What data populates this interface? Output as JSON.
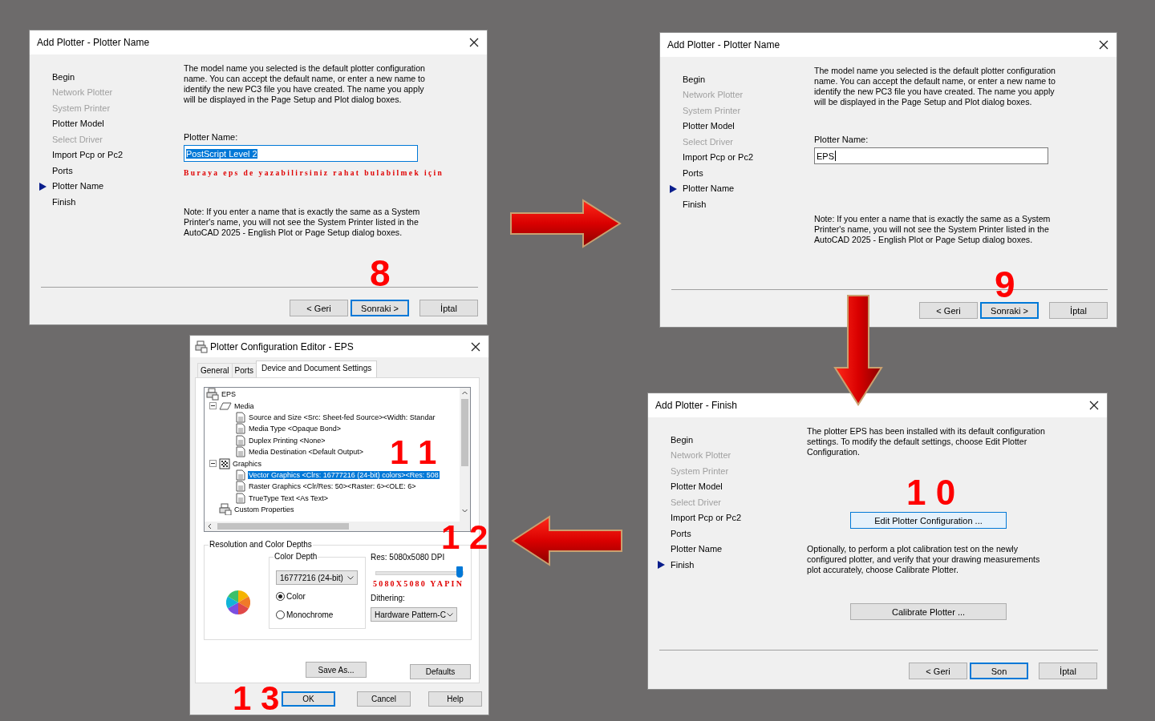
{
  "dialogs": [
    {
      "kind": "wizard",
      "title": "Add Plotter - Plotter Name",
      "steps": [
        {
          "label": "Begin",
          "disabled": false,
          "current": false
        },
        {
          "label": "Network Plotter",
          "disabled": true,
          "current": false
        },
        {
          "label": "System Printer",
          "disabled": true,
          "current": false
        },
        {
          "label": "Plotter Model",
          "disabled": false,
          "current": false
        },
        {
          "label": "Select Driver",
          "disabled": true,
          "current": false
        },
        {
          "label": "Import Pcp or Pc2",
          "disabled": false,
          "current": false
        },
        {
          "label": "Ports",
          "disabled": false,
          "current": false
        },
        {
          "label": "Plotter Name",
          "disabled": false,
          "current": true
        },
        {
          "label": "Finish",
          "disabled": false,
          "current": false
        }
      ],
      "content": [
        {
          "kind": "text",
          "text": "The model name you selected is the default plotter configuration name. You can accept the default name, or enter a new name to identify the new PC3 file you have created. The name you apply will be displayed in the Page Setup and Plot dialog boxes."
        },
        {
          "kind": "field",
          "label": "Plotter Name:",
          "value": "PostScript Level 2",
          "selected": true,
          "caret": false
        },
        {
          "kind": "hint",
          "text": "Buraya eps de yazabilirsiniz rahat bulabilmek için"
        },
        {
          "kind": "text",
          "text": "Note: If you enter a name that is exactly the same as a System Printer's name, you will not see the System Printer listed in the AutoCAD 2025 - English Plot or Page Setup dialog boxes."
        }
      ],
      "badges": [
        "8"
      ],
      "buttons": [
        {
          "label": "< Geri",
          "default": false
        },
        {
          "label": "Sonraki >",
          "default": true
        },
        {
          "label": "İptal",
          "default": false
        }
      ]
    },
    {
      "kind": "wizard",
      "title": "Add Plotter - Plotter Name",
      "steps": [
        {
          "label": "Begin",
          "disabled": false,
          "current": false
        },
        {
          "label": "Network Plotter",
          "disabled": true,
          "current": false
        },
        {
          "label": "System Printer",
          "disabled": true,
          "current": false
        },
        {
          "label": "Plotter Model",
          "disabled": false,
          "current": false
        },
        {
          "label": "Select Driver",
          "disabled": true,
          "current": false
        },
        {
          "label": "Import Pcp or Pc2",
          "disabled": false,
          "current": false
        },
        {
          "label": "Ports",
          "disabled": false,
          "current": false
        },
        {
          "label": "Plotter Name",
          "disabled": false,
          "current": true
        },
        {
          "label": "Finish",
          "disabled": false,
          "current": false
        }
      ],
      "content": [
        {
          "kind": "text",
          "text": "The model name you selected is the default plotter configuration name. You can accept the default name, or enter a new name to identify the new PC3 file you have created. The name you apply will be displayed in the Page Setup and Plot dialog boxes."
        },
        {
          "kind": "field",
          "label": "Plotter Name:",
          "value": "EPS",
          "selected": false,
          "caret": true
        },
        {
          "kind": "text",
          "text": "Note: If you enter a name that is exactly the same as a System Printer's name, you will not see the System Printer listed in the AutoCAD 2025 - English Plot or Page Setup dialog boxes."
        }
      ],
      "badges": [
        "9"
      ],
      "buttons": [
        {
          "label": "< Geri",
          "default": false
        },
        {
          "label": "Sonraki >",
          "default": true
        },
        {
          "label": "İptal",
          "default": false
        }
      ]
    },
    {
      "kind": "config",
      "title": "Plotter Configuration Editor - EPS",
      "tabs": [
        {
          "label": "General",
          "selected": false
        },
        {
          "label": "Ports",
          "selected": false
        },
        {
          "label": "Device and Document Settings",
          "selected": true
        }
      ],
      "tree": [
        {
          "label": "EPS",
          "selected": false,
          "children": [
            {
              "label": "Media",
              "expanded": true,
              "selected": false,
              "children": [
                {
                  "label": "Source and Size <Src:  Sheet-fed Source><Width: Standar",
                  "selected": false
                },
                {
                  "label": "Media Type <Opaque Bond>",
                  "selected": false
                },
                {
                  "label": "Duplex Printing <None>",
                  "selected": false
                },
                {
                  "label": "Media Destination <Default Output>",
                  "selected": false
                }
              ]
            },
            {
              "label": "Graphics",
              "expanded": true,
              "selected": false,
              "children": [
                {
                  "label": "Vector Graphics <Clrs: 16777216  (24-bit) colors><Res: 508",
                  "selected": true
                },
                {
                  "label": "Raster Graphics <Clr/Res: 50><Raster: 6><OLE: 6>",
                  "selected": false
                },
                {
                  "label": "TrueType Text <As Text>",
                  "selected": false
                }
              ]
            },
            {
              "label": "Custom Properties",
              "selected": false
            }
          ]
        }
      ],
      "group_title": "Resolution and Color Depths",
      "color_depth": {
        "title": "Color Depth",
        "value": "16777216  (24-bit)",
        "options": [
          {
            "label": "Color",
            "selected": true
          },
          {
            "label": "Monochrome",
            "selected": false
          }
        ]
      },
      "resolution": {
        "label": "Res: 5080x5080 DPI",
        "level": 0.95,
        "hint": "5080X5080 YAPIN"
      },
      "dithering": {
        "label": "Dithering:",
        "value": "Hardware Pattern-C"
      },
      "panel_buttons": [
        "Save As...",
        "Defaults"
      ],
      "badges": [
        "1 1",
        "1 2",
        "1 3"
      ],
      "buttons": [
        {
          "label": "OK",
          "default": true
        },
        {
          "label": "Cancel",
          "default": false
        },
        {
          "label": "Help",
          "default": false
        }
      ]
    },
    {
      "kind": "wizard",
      "title": "Add Plotter - Finish",
      "steps": [
        {
          "label": "Begin",
          "disabled": false,
          "current": false
        },
        {
          "label": "Network Plotter",
          "disabled": true,
          "current": false
        },
        {
          "label": "System Printer",
          "disabled": true,
          "current": false
        },
        {
          "label": "Plotter Model",
          "disabled": false,
          "current": false
        },
        {
          "label": "Select Driver",
          "disabled": true,
          "current": false
        },
        {
          "label": "Import Pcp or Pc2",
          "disabled": false,
          "current": false
        },
        {
          "label": "Ports",
          "disabled": false,
          "current": false
        },
        {
          "label": "Plotter Name",
          "disabled": false,
          "current": false
        },
        {
          "label": "Finish",
          "disabled": false,
          "current": true
        }
      ],
      "content": [
        {
          "kind": "text",
          "text": "The plotter EPS has been installed with its default configuration settings.  To modify the default settings, choose Edit Plotter Configuration."
        },
        {
          "kind": "button",
          "label": "Edit Plotter Configuration ...",
          "highlighted": true
        },
        {
          "kind": "text",
          "text": "Optionally, to perform a plot calibration test on the newly configured plotter, and verify that your drawing measurements plot accurately, choose Calibrate Plotter."
        },
        {
          "kind": "button",
          "label": "Calibrate Plotter ...",
          "highlighted": false
        }
      ],
      "badges": [
        "1 0"
      ],
      "buttons": [
        {
          "label": "< Geri",
          "default": false
        },
        {
          "label": "Son",
          "default": true
        },
        {
          "label": "İptal",
          "default": false
        }
      ]
    }
  ],
  "arrows": [
    {
      "kind": "right"
    },
    {
      "kind": "down"
    },
    {
      "kind": "left"
    }
  ]
}
